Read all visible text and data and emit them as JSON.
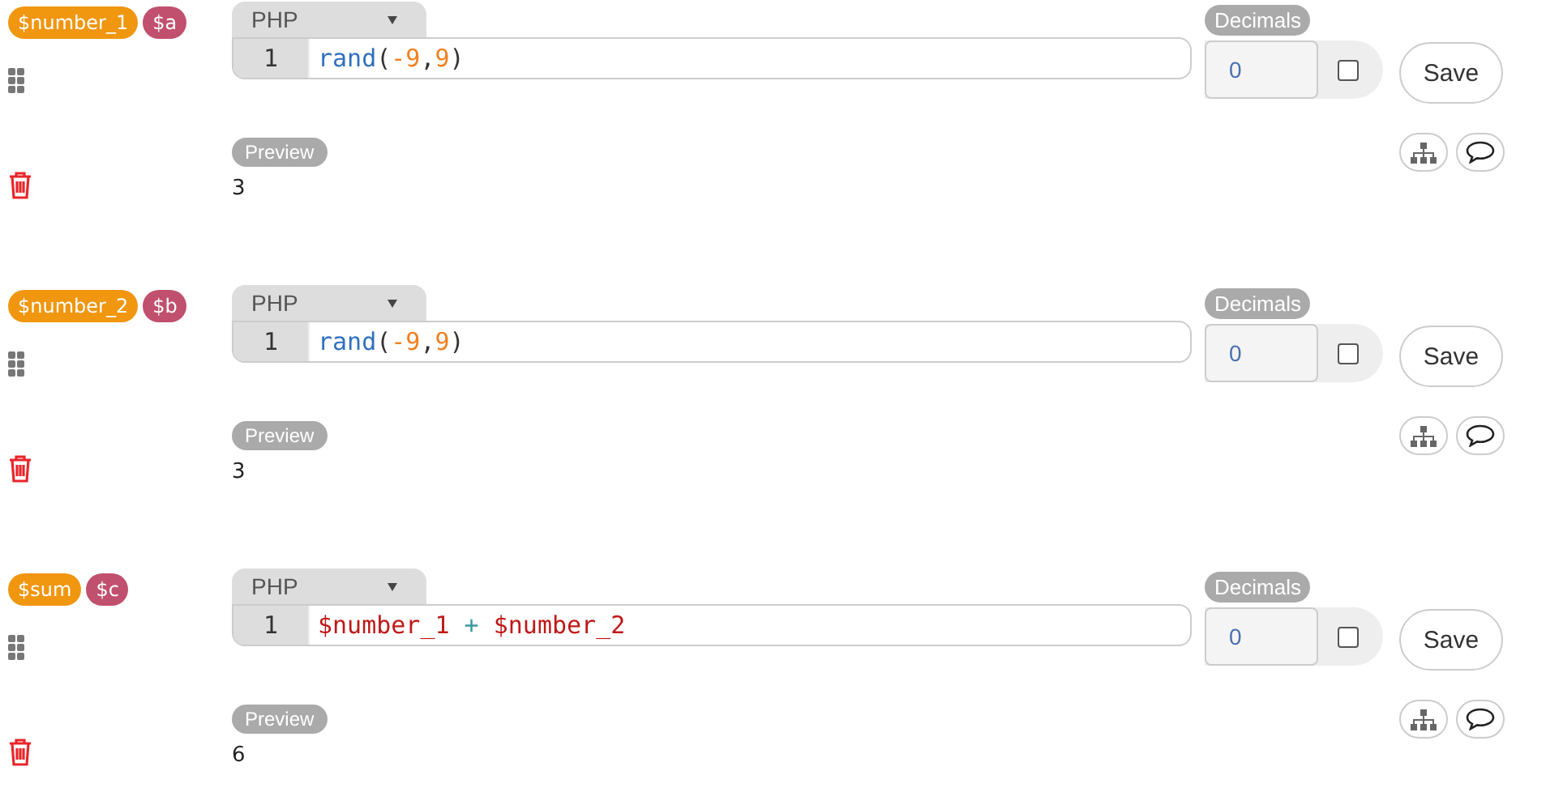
{
  "blocks": [
    {
      "tags": [
        {
          "text": "$number_1",
          "kind": "name"
        },
        {
          "text": "$a",
          "kind": "alias"
        }
      ],
      "language": "PHP",
      "lines": [
        {
          "number": "1",
          "tokens": [
            {
              "text": "rand",
              "kind": "fn"
            },
            {
              "text": "(",
              "kind": "punct"
            },
            {
              "text": "-9",
              "kind": "num"
            },
            {
              "text": ",",
              "kind": "punct"
            },
            {
              "text": "9",
              "kind": "num"
            },
            {
              "text": ")",
              "kind": "punct"
            }
          ]
        }
      ],
      "decimals_label": "Decimals",
      "decimals": "0",
      "decimals_checked": false,
      "save": "Save",
      "preview_label": "Preview",
      "preview": "3"
    },
    {
      "tags": [
        {
          "text": "$number_2",
          "kind": "name"
        },
        {
          "text": "$b",
          "kind": "alias"
        }
      ],
      "language": "PHP",
      "lines": [
        {
          "number": "1",
          "tokens": [
            {
              "text": "rand",
              "kind": "fn"
            },
            {
              "text": "(",
              "kind": "punct"
            },
            {
              "text": "-9",
              "kind": "num"
            },
            {
              "text": ",",
              "kind": "punct"
            },
            {
              "text": "9",
              "kind": "num"
            },
            {
              "text": ")",
              "kind": "punct"
            }
          ]
        }
      ],
      "decimals_label": "Decimals",
      "decimals": "0",
      "decimals_checked": false,
      "save": "Save",
      "preview_label": "Preview",
      "preview": "3"
    },
    {
      "tags": [
        {
          "text": "$sum",
          "kind": "name"
        },
        {
          "text": "$c",
          "kind": "alias"
        }
      ],
      "language": "PHP",
      "lines": [
        {
          "number": "1",
          "tokens": [
            {
              "text": "$number_1",
              "kind": "var"
            },
            {
              "text": " + ",
              "kind": "op"
            },
            {
              "text": "$number_2",
              "kind": "var"
            }
          ]
        }
      ],
      "decimals_label": "Decimals",
      "decimals": "0",
      "decimals_checked": false,
      "save": "Save",
      "preview_label": "Preview",
      "preview": "6"
    }
  ]
}
